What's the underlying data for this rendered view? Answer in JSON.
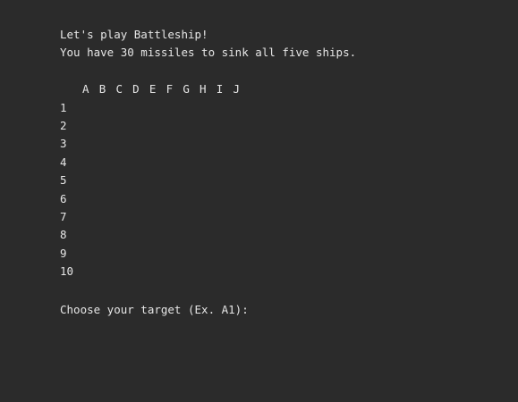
{
  "console": {
    "intro_line_1": "Let's play Battleship!",
    "intro_line_2": "You have 30 missiles to sink all five ships.",
    "prompt": "Choose your target (Ex. A1): "
  },
  "board": {
    "columns": [
      "A",
      "B",
      "C",
      "D",
      "E",
      "F",
      "G",
      "H",
      "I",
      "J"
    ],
    "rows": [
      "1",
      "2",
      "3",
      "4",
      "5",
      "6",
      "7",
      "8",
      "9",
      "10"
    ]
  },
  "colors": {
    "background": "#2b2b2b",
    "text": "#e6e6e6"
  }
}
